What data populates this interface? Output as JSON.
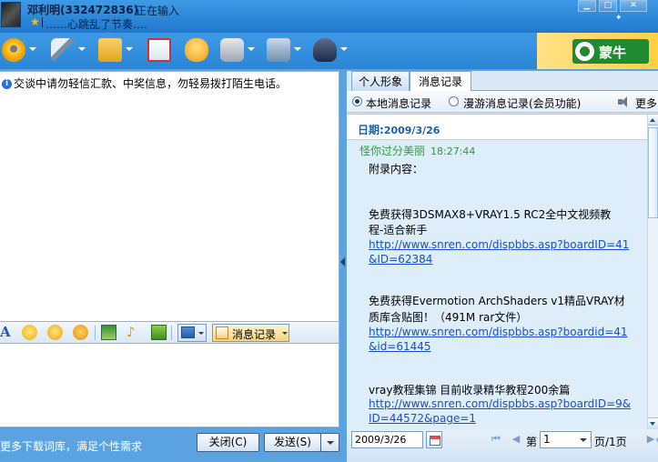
{
  "title_bar": {
    "contact_name": "邓利明(332472836)",
    "status": "正在输入",
    "signature": "……心跳乱了节奏…."
  },
  "ad": {
    "brand": "蒙牛"
  },
  "toolbar": {
    "items": [
      {
        "icon": "video-icon"
      },
      {
        "icon": "voice-icon"
      },
      {
        "icon": "send-file-icon"
      },
      {
        "icon": "mail-icon"
      },
      {
        "icon": "chat-bubble-icon"
      },
      {
        "icon": "game-icon"
      },
      {
        "icon": "app-icon"
      },
      {
        "icon": "agent-icon"
      }
    ]
  },
  "chat": {
    "notice": "交谈中请勿轻信汇款、中奖信息，勿轻易拨打陌生电话。"
  },
  "edit_toolbar": {
    "font_glyph": "A",
    "history_button": "消息记录"
  },
  "footer": {
    "hint": "更多下载词库，满足个性需求",
    "close_button": "关闭(C)",
    "send_button": "发送(S)"
  },
  "right_pane": {
    "tabs": [
      {
        "label": "个人形象"
      },
      {
        "label": "消息记录"
      }
    ],
    "options": {
      "local": "本地消息记录",
      "roaming": "漫游消息记录(会员功能)",
      "more": "更多"
    },
    "date_prefix": "日期:",
    "date": "2009/3/26",
    "message": {
      "sender": "怪你过分美丽",
      "time": "18:27:44",
      "lines": [
        {
          "text": "附录内容：",
          "link": false
        },
        {
          "text": "免费获得3DSMAX8+VRAY1.5 RC2全中文视频教",
          "link": false
        },
        {
          "text": "程-适合新手",
          "link": false
        },
        {
          "text": "http://www.snren.com/dispbbs.asp?boardID=41",
          "link": true
        },
        {
          "text": "&ID=62384",
          "link": true
        },
        {
          "text": "免费获得Evermotion ArchShaders v1精品VRAY材",
          "link": false
        },
        {
          "text": "质库含贴图！（491M rar文件）",
          "link": false
        },
        {
          "text": "http://www.snren.com/dispbbs.asp?boardid=41",
          "link": true
        },
        {
          "text": "&id=61445",
          "link": true
        },
        {
          "text": "vray教程集锦 目前收录精华教程200余篇",
          "link": false
        },
        {
          "text": "http://www.snren.com/dispbbs.asp?boardID=9&",
          "link": true
        },
        {
          "text": "ID=44572&page=1",
          "link": true
        }
      ]
    },
    "pager": {
      "date_value": "2009/3/26",
      "page_prefix": "第",
      "page_value": "1",
      "page_suffix": "页/1页"
    }
  }
}
